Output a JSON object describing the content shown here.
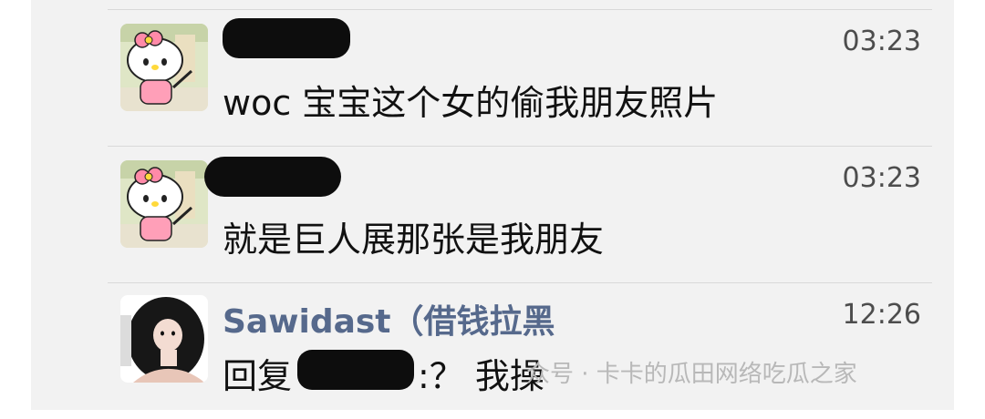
{
  "chats": [
    {
      "time": "03:23",
      "message": "woc 宝宝这个女的偷我朋友照片"
    },
    {
      "time": "03:23",
      "message": "就是巨人展那张是我朋友"
    },
    {
      "name": "Sawidast（借钱拉黑",
      "time": "12:26",
      "reply_prefix": "回复",
      "reply_suffix": ":？ 我操"
    }
  ],
  "watermark": "众号 · 卡卡的瓜田网络吃瓜之家"
}
